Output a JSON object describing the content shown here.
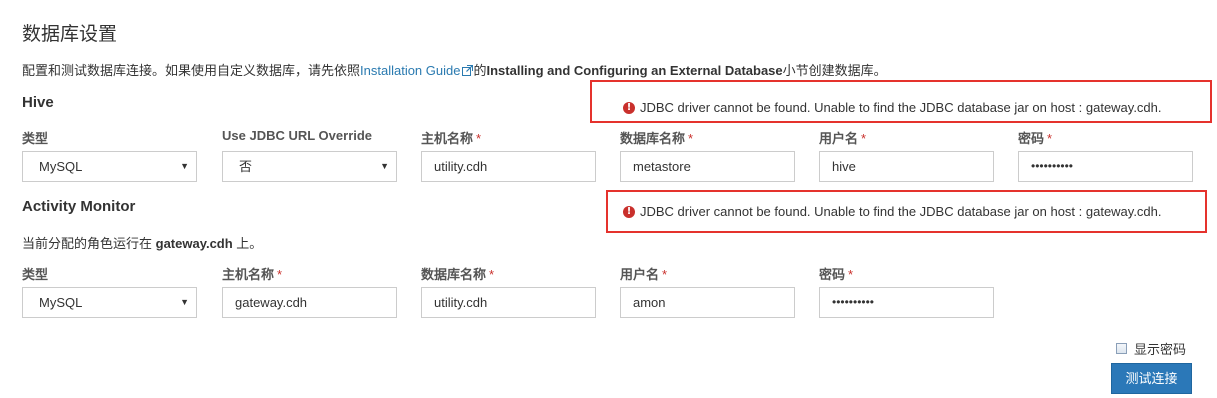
{
  "page": {
    "title": "数据库设置",
    "desc_prefix": "配置和测试数据库连接。如果使用自定义数据库，请先依照",
    "desc_link": "Installation Guide",
    "desc_middle": "的",
    "desc_bold": "Installing and Configuring an External Database",
    "desc_suffix": "小节创建数据库。"
  },
  "hive": {
    "section_title": "Hive",
    "error": "JDBC driver cannot be found. Unable to find the JDBC database jar on host : gateway.cdh.",
    "labels": {
      "type": "类型",
      "jdbc_override": "Use JDBC URL Override",
      "host": "主机名称",
      "db_name": "数据库名称",
      "username": "用户名",
      "password": "密码"
    },
    "values": {
      "type": "MySQL",
      "jdbc_override": "否",
      "host": "utility.cdh",
      "db_name": "metastore",
      "username": "hive",
      "password": "••••••••••"
    }
  },
  "activity_monitor": {
    "section_title": "Activity Monitor",
    "error": "JDBC driver cannot be found. Unable to find the JDBC database jar on host : gateway.cdh.",
    "host_note_prefix": "当前分配的角色运行在 ",
    "host_note_host": "gateway.cdh",
    "host_note_suffix": " 上。",
    "labels": {
      "type": "类型",
      "host": "主机名称",
      "db_name": "数据库名称",
      "username": "用户名",
      "password": "密码"
    },
    "values": {
      "type": "MySQL",
      "host": "gateway.cdh",
      "db_name": "utility.cdh",
      "username": "amon",
      "password": "••••••••••"
    }
  },
  "required_mark": "*",
  "show_password_label": "显示密码",
  "test_button_label": "测试连接",
  "colors": {
    "error_border": "#e5322d",
    "error_icon": "#c9302c",
    "link": "#2a7ab0",
    "button": "#2b78b8"
  },
  "icons": {
    "external_link": "external-link-icon",
    "error": "exclamation-circle-icon",
    "select_caret": "caret-down-icon"
  }
}
